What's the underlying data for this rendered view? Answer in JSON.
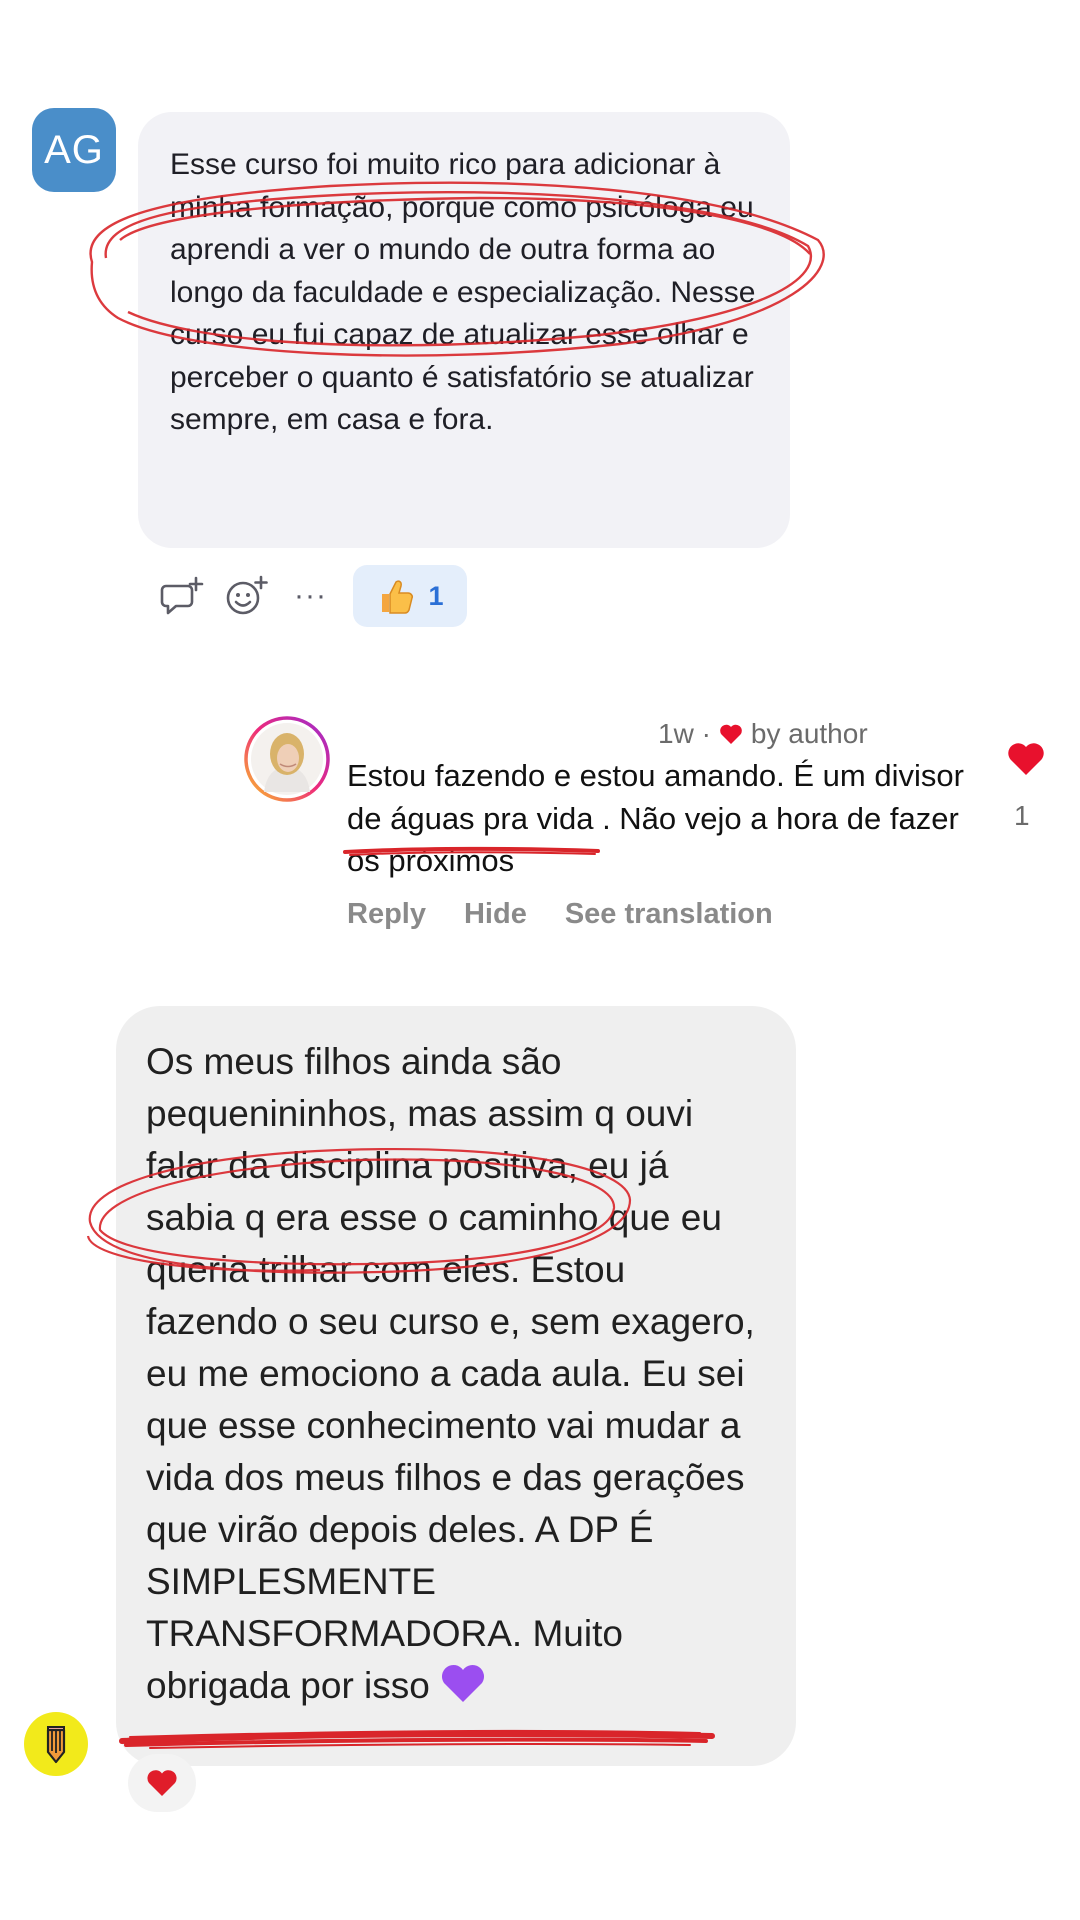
{
  "message1": {
    "avatar_initials": "AG",
    "text": "Esse curso foi muito rico para adicionar à minha formação, porque como psicóloga eu aprendi a ver o mundo de outra forma ao longo da faculdade e especialização. Nesse curso eu fui capaz de atualizar esse olhar e perceber o quanto é satisfatório se atualizar sempre, em casa e fora.",
    "actions": {
      "reply_icon": "reply-plus-icon",
      "react_icon": "emoji-add-icon",
      "more_label": "···"
    },
    "reaction": {
      "emoji_icon": "thumbs-up-icon",
      "count": "1"
    }
  },
  "reply": {
    "meta_time": "1w ·",
    "meta_liked": "by author",
    "text": "Estou fazendo e estou amando. É um divisor de águas pra vida . Não vejo a hora de fazer os próximos",
    "actions": {
      "reply": "Reply",
      "hide": "Hide",
      "translate": "See translation"
    },
    "like_count": "1"
  },
  "message2": {
    "text": "Os meus filhos ainda são pequenininhos, mas assim q ouvi falar da disciplina positiva, eu já sabia q era esse o caminho que eu queria trilhar com eles. Estou fazendo o seu curso e, sem exagero, eu me emociono a cada aula. Eu sei que esse conhecimento vai mudar a vida dos meus filhos e das gerações que virão depois deles. A DP É SIMPLESMENTE TRANSFORMADORA. Muito obrigada por isso",
    "reaction_icon": "red-heart-icon"
  },
  "colors": {
    "avatar_blue": "#4a8ec9",
    "bubble_gray": "#f2f2f6",
    "reaction_pill": "#e4eefb",
    "reaction_text": "#2a6fd6",
    "annotation_red": "#d9252a",
    "heart_red": "#e8112d",
    "pencil_avatar_yellow": "#f2ea1b"
  }
}
